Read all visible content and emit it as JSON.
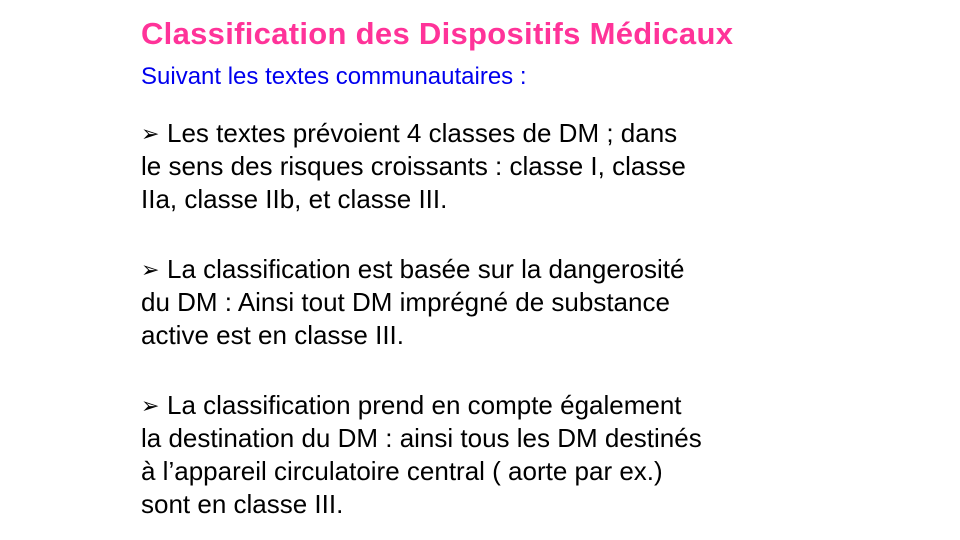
{
  "colors": {
    "title": "#ff3399",
    "subtitle": "#0000ee",
    "body": "#000000"
  },
  "slide": {
    "title": "Classification des Dispositifs Médicaux",
    "subtitle": "Suivant les textes communautaires :",
    "bullet_icon": "arrow-bullet-icon",
    "bullet_glyph": "➢",
    "bullets": [
      {
        "lines": [
          "Les textes prévoient 4 classes de DM ; dans",
          "le sens des risques croissants  : classe I, classe",
          "IIa, classe IIb, et classe III."
        ]
      },
      {
        "lines": [
          "La classification est basée sur la dangerosité",
          "du DM : Ainsi tout DM imprégné de substance",
          "active est en classe III."
        ]
      },
      {
        "lines": [
          "La classification prend en compte également",
          "la destination du DM : ainsi tous les DM destinés",
          "à l’appareil circulatoire central ( aorte par ex.)",
          "sont en classe III."
        ]
      }
    ]
  }
}
